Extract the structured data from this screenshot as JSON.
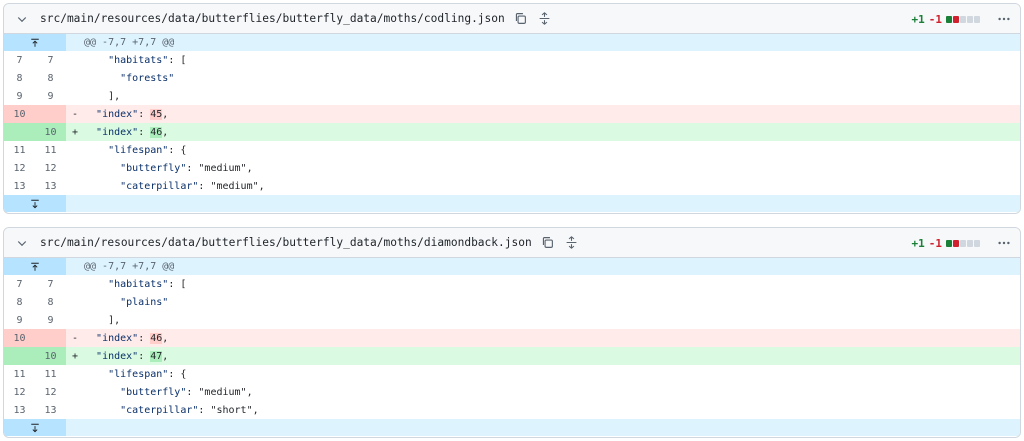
{
  "colors": {
    "add_block": "#1a7f37",
    "del_block": "#cf222e",
    "neutral_block": "#d0d7de"
  },
  "files": [
    {
      "path": "src/main/resources/data/butterflies/butterfly_data/moths/codling.json",
      "stat_add": "+1",
      "stat_del": "-1",
      "hunk_header": "@@ -7,7 +7,7 @@",
      "lines": [
        {
          "type": "ctx",
          "old": "7",
          "new": "7",
          "marker": "",
          "indent": "    ",
          "key": "\"habitats\"",
          "rest": ": ["
        },
        {
          "type": "ctx",
          "old": "8",
          "new": "8",
          "marker": "",
          "indent": "      ",
          "key": "\"forests\"",
          "rest": ""
        },
        {
          "type": "ctx",
          "old": "9",
          "new": "9",
          "marker": "",
          "indent": "    ",
          "key": "",
          "rest": "],"
        },
        {
          "type": "del",
          "old": "10",
          "new": "",
          "marker": "-",
          "indent": "  ",
          "key": "\"index\"",
          "rest": ": ",
          "hl": "45",
          "after": ","
        },
        {
          "type": "add",
          "old": "",
          "new": "10",
          "marker": "+",
          "indent": "  ",
          "key": "\"index\"",
          "rest": ": ",
          "hl": "46",
          "after": ","
        },
        {
          "type": "ctx",
          "old": "11",
          "new": "11",
          "marker": "",
          "indent": "    ",
          "key": "\"lifespan\"",
          "rest": ": {"
        },
        {
          "type": "ctx",
          "old": "12",
          "new": "12",
          "marker": "",
          "indent": "      ",
          "key": "\"butterfly\"",
          "rest": ": \"medium\","
        },
        {
          "type": "ctx",
          "old": "13",
          "new": "13",
          "marker": "",
          "indent": "      ",
          "key": "\"caterpillar\"",
          "rest": ": \"medium\","
        }
      ]
    },
    {
      "path": "src/main/resources/data/butterflies/butterfly_data/moths/diamondback.json",
      "stat_add": "+1",
      "stat_del": "-1",
      "hunk_header": "@@ -7,7 +7,7 @@",
      "lines": [
        {
          "type": "ctx",
          "old": "7",
          "new": "7",
          "marker": "",
          "indent": "    ",
          "key": "\"habitats\"",
          "rest": ": ["
        },
        {
          "type": "ctx",
          "old": "8",
          "new": "8",
          "marker": "",
          "indent": "      ",
          "key": "\"plains\"",
          "rest": ""
        },
        {
          "type": "ctx",
          "old": "9",
          "new": "9",
          "marker": "",
          "indent": "    ",
          "key": "",
          "rest": "],"
        },
        {
          "type": "del",
          "old": "10",
          "new": "",
          "marker": "-",
          "indent": "  ",
          "key": "\"index\"",
          "rest": ": ",
          "hl": "46",
          "after": ","
        },
        {
          "type": "add",
          "old": "",
          "new": "10",
          "marker": "+",
          "indent": "  ",
          "key": "\"index\"",
          "rest": ": ",
          "hl": "47",
          "after": ","
        },
        {
          "type": "ctx",
          "old": "11",
          "new": "11",
          "marker": "",
          "indent": "    ",
          "key": "\"lifespan\"",
          "rest": ": {"
        },
        {
          "type": "ctx",
          "old": "12",
          "new": "12",
          "marker": "",
          "indent": "      ",
          "key": "\"butterfly\"",
          "rest": ": \"medium\","
        },
        {
          "type": "ctx",
          "old": "13",
          "new": "13",
          "marker": "",
          "indent": "      ",
          "key": "\"caterpillar\"",
          "rest": ": \"short\","
        }
      ]
    }
  ]
}
